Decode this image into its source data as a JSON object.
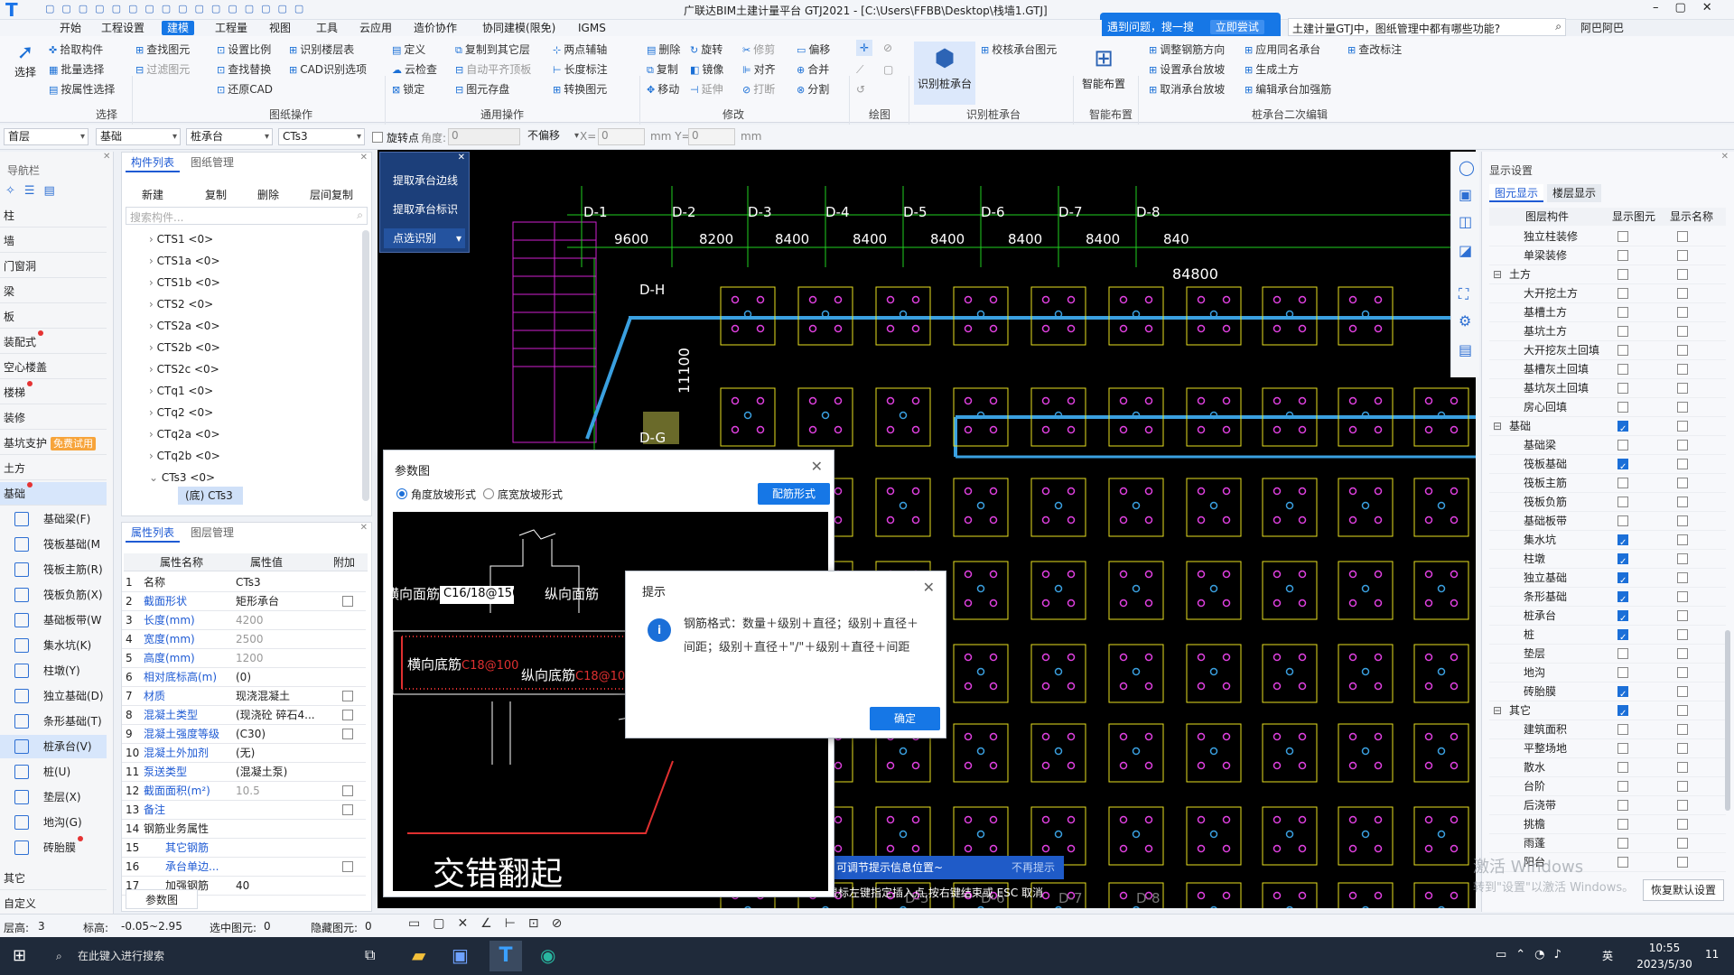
{
  "window": {
    "title": "广联达BIM土建计量平台 GTJ2021 - [C:\\Users\\FFBB\\Desktop\\栈墙1.GTJ]",
    "search_placeholder": "土建计量GTJ中，图纸管理中都有哪些功能?",
    "user": "阿巴阿巴",
    "help_banner": "遇到问题，搜一搜",
    "help_try": "立即尝试"
  },
  "tabs": [
    "开始",
    "工程设置",
    "建模",
    "工程量",
    "视图",
    "工具",
    "云应用",
    "造价协作",
    "协同建模(限免)",
    "IGMS"
  ],
  "ribbon": {
    "select": {
      "big": "选择",
      "items": [
        "拾取构件",
        "批量选择",
        "按属性选择"
      ],
      "group": "选择"
    },
    "drawing_ops": {
      "items": [
        "查找图元",
        "过滤图元",
        "设置比例",
        "查找替换",
        "还原CAD",
        "识别楼层表",
        "CAD识别选项"
      ],
      "group": "图纸操作"
    },
    "general": {
      "items": [
        "定义",
        "云检查",
        "锁定",
        "复制到其它层",
        "自动平齐顶板",
        "图元存盘",
        "两点辅轴",
        "长度标注",
        "转换图元"
      ],
      "group": "通用操作"
    },
    "modify": {
      "items": [
        "删除",
        "旋转",
        "修剪",
        "偏移",
        "复制",
        "镜像",
        "对齐",
        "合并",
        "移动",
        "延伸",
        "打断",
        "分割"
      ],
      "group": "修改"
    },
    "draw": {
      "group": "绘图"
    },
    "identify": {
      "big": "识别桩承台",
      "item": "校核承台图元",
      "group": "识别桩承台"
    },
    "smart": {
      "big": "智能布置",
      "group": "智能布置"
    },
    "edit2": {
      "items": [
        "调整钢筋方向",
        "应用同名承台",
        "查改标注",
        "设置承台放坡",
        "生成土方",
        "取消承台放坡",
        "编辑承台加强筋"
      ],
      "group": "桩承台二次编辑"
    }
  },
  "toolbar2": {
    "floor": "首层",
    "type": "基础",
    "subtype": "桩承台",
    "component": "CTs3",
    "rotate_label": "旋转点",
    "angle_label": "角度:",
    "angle": "0",
    "offset": "不偏移",
    "x_label": "X=",
    "x": "0",
    "mm1": "mm Y=",
    "y": "0",
    "mm2": "mm"
  },
  "nav": {
    "title": "导航栏",
    "items": [
      "柱",
      "墙",
      "门窗洞",
      "梁",
      "板",
      "装配式",
      "空心楼盖",
      "楼梯",
      "装修",
      "基坑支护",
      "土方",
      "基础"
    ],
    "badge": "免费试用",
    "subitems": [
      "基础梁(F)",
      "筏板基础(M",
      "筏板主筋(R)",
      "筏板负筋(X)",
      "基础板带(W",
      "集水坑(K)",
      "柱墩(Y)",
      "独立基础(D)",
      "条形基础(T)",
      "桩承台(V)",
      "桩(U)",
      "垫层(X)",
      "地沟(G)",
      "砖胎膜"
    ],
    "bottom": [
      "其它",
      "自定义"
    ]
  },
  "components": {
    "tabs": [
      "构件列表",
      "图纸管理"
    ],
    "toolbar": [
      "新建",
      "复制",
      "删除",
      "层间复制"
    ],
    "search": "搜索构件...",
    "items": [
      "CTS1 <0>",
      "CTS1a <0>",
      "CTS1b <0>",
      "CTS2 <0>",
      "CTS2a <0>",
      "CTS2b <0>",
      "CTS2c <0>",
      "CTq1 <0>",
      "CTq2 <0>",
      "CTq2a <0>",
      "CTq2b <0>",
      "CTs3 <0>"
    ],
    "child": "(底) CTs3"
  },
  "props": {
    "tabs": [
      "属性列表",
      "图层管理"
    ],
    "headers": [
      "属性名称",
      "属性值",
      "附加"
    ],
    "rows": [
      [
        "1",
        "名称",
        "CTs3"
      ],
      [
        "2",
        "截面形状",
        "矩形承台"
      ],
      [
        "3",
        "长度(mm)",
        "4200"
      ],
      [
        "4",
        "宽度(mm)",
        "2500"
      ],
      [
        "5",
        "高度(mm)",
        "1200"
      ],
      [
        "6",
        "相对底标高(m)",
        "(0)"
      ],
      [
        "7",
        "材质",
        "现浇混凝土"
      ],
      [
        "8",
        "混凝土类型",
        "(现浇砼 碎石4..."
      ],
      [
        "9",
        "混凝土强度等级",
        "(C30)"
      ],
      [
        "10",
        "混凝土外加剂",
        "(无)"
      ],
      [
        "11",
        "泵送类型",
        "(混凝土泵)"
      ],
      [
        "12",
        "截面面积(m²)",
        "10.5"
      ],
      [
        "13",
        "备注",
        ""
      ],
      [
        "14",
        "钢筋业务属性",
        ""
      ],
      [
        "15",
        "其它钢筋",
        ""
      ],
      [
        "16",
        "承台单边...",
        ""
      ],
      [
        "17",
        "加强钢筋",
        "40"
      ]
    ],
    "footer": "参数图"
  },
  "float_menu": [
    "提取承台边线",
    "提取承台标识",
    "点选识别"
  ],
  "cad": {
    "axes": [
      "D-1",
      "D-2",
      "D-3",
      "D-4",
      "D-5",
      "D-6",
      "D-7",
      "D-8"
    ],
    "dims": [
      "9600",
      "8200",
      "8400",
      "8400",
      "8400",
      "8400",
      "8400",
      "840"
    ],
    "total": "84800",
    "vertical": "11100",
    "rows": [
      "D-H",
      "D-G"
    ],
    "bottom_axes": [
      "D-5",
      "D-6",
      "D-7",
      "D-8"
    ],
    "tip_text": "可调节提示信息位置~",
    "tip_no": "不再提示",
    "cmd": "鼠标左键指定插入点,按右键结束或 ESC 取消"
  },
  "param_dialog": {
    "title": "参数图",
    "opt1": "角度放坡形式",
    "opt2": "底宽放坡形式",
    "button": "配筋形式",
    "rebar_label": "横向面筋",
    "rebar_value": "C16/18@150",
    "top_long": "纵向面筋",
    "bottom_cross": "横向底筋",
    "bottom_cross_v": "C18@100",
    "bottom_long": "纵向底筋",
    "bottom_long_v": "C18@10",
    "caption": "交错翻起"
  },
  "tip_dialog": {
    "title": "提示",
    "message": "钢筋格式：数量＋级别＋直径；级别＋直径＋间距；级别＋直径＋\"/\"＋级别＋直径＋间距",
    "ok": "确定"
  },
  "display": {
    "title": "显示设置",
    "tabs": [
      "图元显示",
      "楼层显示"
    ],
    "headers": [
      "图层构件",
      "显示图元",
      "显示名称"
    ],
    "rows": [
      {
        "n": "独立柱装修",
        "a": false,
        "b": false,
        "g": false
      },
      {
        "n": "单梁装修",
        "a": false,
        "b": false,
        "g": false
      },
      {
        "n": "土方",
        "a": false,
        "b": false,
        "g": true
      },
      {
        "n": "大开挖土方",
        "a": false,
        "b": false,
        "g": false
      },
      {
        "n": "基槽土方",
        "a": false,
        "b": false,
        "g": false
      },
      {
        "n": "基坑土方",
        "a": false,
        "b": false,
        "g": false
      },
      {
        "n": "大开挖灰土回填",
        "a": false,
        "b": false,
        "g": false
      },
      {
        "n": "基槽灰土回填",
        "a": false,
        "b": false,
        "g": false
      },
      {
        "n": "基坑灰土回填",
        "a": false,
        "b": false,
        "g": false
      },
      {
        "n": "房心回填",
        "a": false,
        "b": false,
        "g": false
      },
      {
        "n": "基础",
        "a": true,
        "b": false,
        "g": true
      },
      {
        "n": "基础梁",
        "a": false,
        "b": false,
        "g": false
      },
      {
        "n": "筏板基础",
        "a": true,
        "b": false,
        "g": false
      },
      {
        "n": "筏板主筋",
        "a": false,
        "b": false,
        "g": false
      },
      {
        "n": "筏板负筋",
        "a": false,
        "b": false,
        "g": false
      },
      {
        "n": "基础板带",
        "a": false,
        "b": false,
        "g": false
      },
      {
        "n": "集水坑",
        "a": true,
        "b": false,
        "g": false
      },
      {
        "n": "柱墩",
        "a": true,
        "b": false,
        "g": false
      },
      {
        "n": "独立基础",
        "a": true,
        "b": false,
        "g": false
      },
      {
        "n": "条形基础",
        "a": true,
        "b": false,
        "g": false
      },
      {
        "n": "桩承台",
        "a": true,
        "b": false,
        "g": false
      },
      {
        "n": "桩",
        "a": true,
        "b": false,
        "g": false
      },
      {
        "n": "垫层",
        "a": false,
        "b": false,
        "g": false
      },
      {
        "n": "地沟",
        "a": false,
        "b": false,
        "g": false
      },
      {
        "n": "砖胎膜",
        "a": true,
        "b": false,
        "g": false
      },
      {
        "n": "其它",
        "a": true,
        "b": false,
        "g": true
      },
      {
        "n": "建筑面积",
        "a": false,
        "b": false,
        "g": false
      },
      {
        "n": "平整场地",
        "a": false,
        "b": false,
        "g": false
      },
      {
        "n": "散水",
        "a": false,
        "b": false,
        "g": false
      },
      {
        "n": "台阶",
        "a": false,
        "b": false,
        "g": false
      },
      {
        "n": "后浇带",
        "a": false,
        "b": false,
        "g": false
      },
      {
        "n": "挑檐",
        "a": false,
        "b": false,
        "g": false
      },
      {
        "n": "雨蓬",
        "a": false,
        "b": false,
        "g": false
      },
      {
        "n": "阳台",
        "a": false,
        "b": false,
        "g": false
      }
    ],
    "restore": "恢复默认设置",
    "watermark1": "激活 Windows",
    "watermark2": "转到\"设置\"以激活 Windows。"
  },
  "status": {
    "floor_label": "层高:",
    "floor": "3",
    "elev_label": "标高:",
    "elev": "-0.05~2.95",
    "sel_label": "选中图元:",
    "sel": "0",
    "hidden_label": "隐藏图元:",
    "hidden": "0"
  },
  "taskbar": {
    "search": "在此键入进行搜索",
    "time": "10:55",
    "date": "2023/5/30",
    "ime": "英",
    "notify": "11"
  }
}
